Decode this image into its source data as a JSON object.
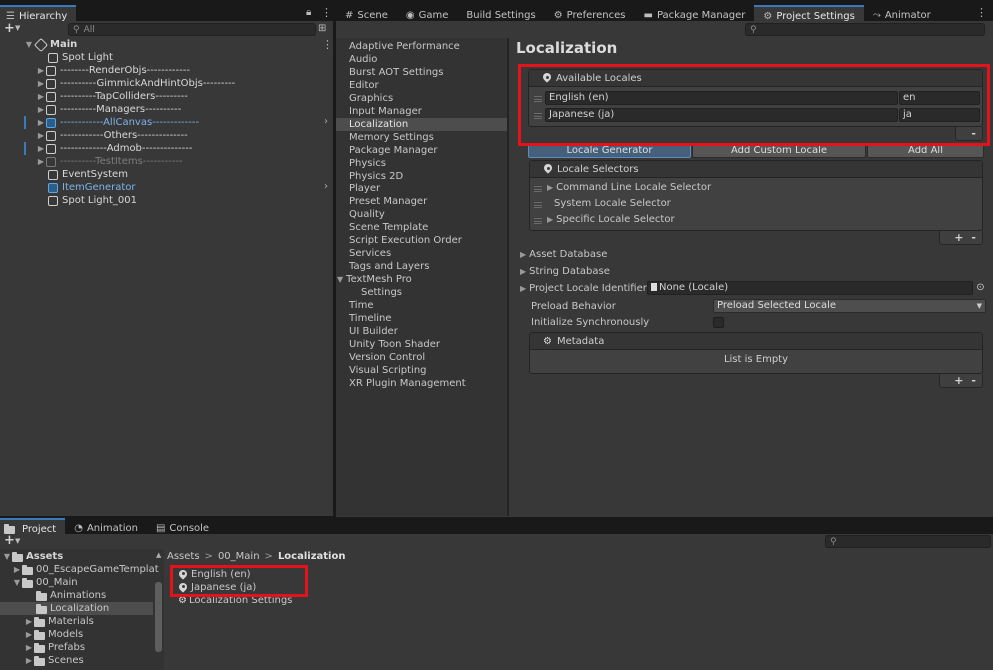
{
  "hierarchy": {
    "tab_label": "Hierarchy",
    "search_placeholder": "All",
    "items": [
      {
        "label": "Main",
        "expanded": true
      },
      {
        "label": "Spot Light"
      },
      {
        "label": "--------RenderObjs------------"
      },
      {
        "label": "----------GimmickAndHintObjs---------"
      },
      {
        "label": "----------TapColliders---------"
      },
      {
        "label": "----------Managers----------"
      },
      {
        "label": "------------AllCanvas-------------"
      },
      {
        "label": "------------Others--------------"
      },
      {
        "label": "-------------Admob--------------"
      },
      {
        "label": "----------TestItems-----------"
      },
      {
        "label": "EventSystem"
      },
      {
        "label": "ItemGenerator"
      },
      {
        "label": "Spot Light_001"
      }
    ]
  },
  "top_tabs": [
    {
      "label": "Scene",
      "icon": "hash-icon"
    },
    {
      "label": "Game",
      "icon": "gamepad-icon"
    },
    {
      "label": "Build Settings",
      "icon": ""
    },
    {
      "label": "Preferences",
      "icon": "gear-icon"
    },
    {
      "label": "Package Manager",
      "icon": "package-icon"
    },
    {
      "label": "Project Settings",
      "icon": "gear-icon"
    },
    {
      "label": "Animator",
      "icon": "animator-icon"
    }
  ],
  "settings_list": [
    "Adaptive Performance",
    "Audio",
    "Burst AOT Settings",
    "Editor",
    "Graphics",
    "Input Manager",
    "Localization",
    "Memory Settings",
    "Package Manager",
    "Physics",
    "Physics 2D",
    "Player",
    "Preset Manager",
    "Quality",
    "Scene Template",
    "Script Execution Order",
    "Services",
    "Tags and Layers",
    "TextMesh Pro",
    "Settings",
    "Time",
    "Timeline",
    "UI Builder",
    "Unity Toon Shader",
    "Version Control",
    "Visual Scripting",
    "XR Plugin Management"
  ],
  "localization": {
    "title": "Localization",
    "available_locales_label": "Available Locales",
    "locales": [
      {
        "name": "English (en)",
        "code": "en"
      },
      {
        "name": "Japanese (ja)",
        "code": "ja"
      }
    ],
    "minus_label": "-",
    "buttons": {
      "locale_generator": "Locale Generator",
      "add_custom_locale": "Add Custom Locale",
      "add_all": "Add All"
    },
    "locale_selectors_label": "Locale Selectors",
    "selectors": [
      "Command Line Locale Selector",
      "System Locale Selector",
      "Specific Locale Selector"
    ],
    "plus_label": "+",
    "asset_database": "Asset Database",
    "string_database": "String Database",
    "project_locale_identifier_label": "Project Locale Identifier",
    "project_locale_identifier_value": "None (Locale)",
    "preload_behavior_label": "Preload Behavior",
    "preload_behavior_value": "Preload Selected Locale",
    "init_sync_label": "Initialize Synchronously",
    "metadata_label": "Metadata",
    "list_empty": "List is Empty"
  },
  "bottom_tabs": [
    {
      "label": "Project",
      "icon": "folder-icon"
    },
    {
      "label": "Animation",
      "icon": "clock-icon"
    },
    {
      "label": "Console",
      "icon": "console-icon"
    }
  ],
  "project": {
    "tree": [
      {
        "label": "Assets",
        "bold": true
      },
      {
        "label": "00_EscapeGameTemplat"
      },
      {
        "label": "00_Main"
      },
      {
        "label": "Animations"
      },
      {
        "label": "Localization"
      },
      {
        "label": "Materials"
      },
      {
        "label": "Models"
      },
      {
        "label": "Prefabs"
      },
      {
        "label": "Scenes"
      }
    ],
    "breadcrumb": [
      "Assets",
      "00_Main",
      "Localization"
    ],
    "breadcrumb_sep": ">",
    "files": [
      "English (en)",
      "Japanese (ja)",
      "Localization Settings"
    ]
  },
  "colors": {
    "accent": "#3a79bb",
    "highlight": "#e3121b",
    "prefab_blue": "#7cb3ea"
  }
}
